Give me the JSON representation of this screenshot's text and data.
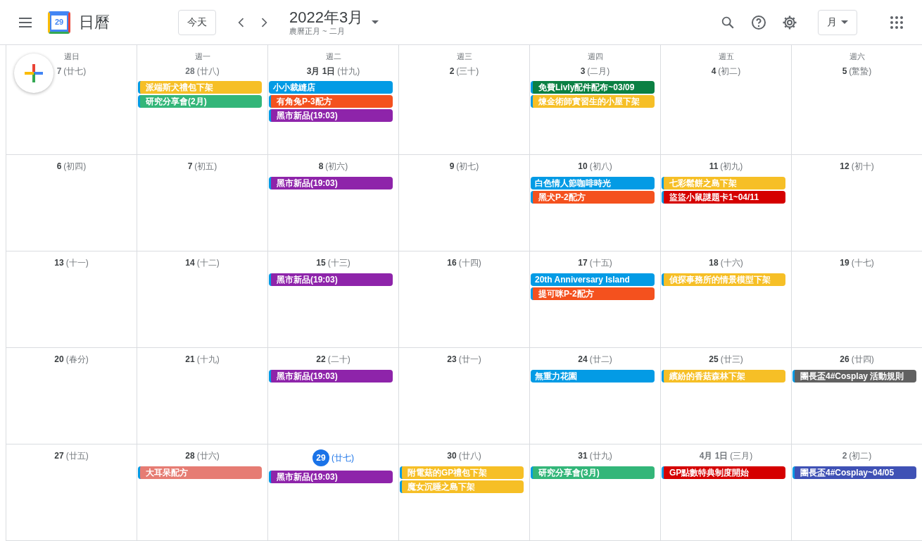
{
  "header": {
    "logo_text": "29",
    "app_name": "日曆",
    "today_button": "今天",
    "title": "2022年3月",
    "subtitle": "農曆正月 ~ 二月",
    "view_button": "月"
  },
  "weekdays": [
    "週日",
    "週一",
    "週二",
    "週三",
    "週四",
    "週五",
    "週六"
  ],
  "weeks": [
    {
      "days": [
        {
          "date": "7",
          "lunar": "(廿七)",
          "in_month": false,
          "today": false
        },
        {
          "date": "28",
          "lunar": "(廿八)",
          "in_month": false,
          "today": false,
          "events": [
            {
              "title": "派端斯犬禮包下架",
              "color": "#f6bf26",
              "striped": true
            },
            {
              "title": "研究分享會(2月)",
              "color": "#33b679",
              "striped": true
            }
          ]
        },
        {
          "date": "3月 1日",
          "lunar": "(廿九)",
          "in_month": true,
          "today": false,
          "events": [
            {
              "title": "小小裁縫店",
              "color": "#039be5",
              "striped": false
            },
            {
              "title": "有角兔P-3配方",
              "color": "#f4511e",
              "striped": true
            },
            {
              "title": "黑市新品(19:03)",
              "color": "#8e24aa",
              "striped": true
            }
          ]
        },
        {
          "date": "2",
          "lunar": "(三十)",
          "in_month": true,
          "today": false
        },
        {
          "date": "3",
          "lunar": "(二月)",
          "in_month": true,
          "today": false,
          "events": [
            {
              "title": "免費Livly配件配布~03/09",
              "color": "#0b8043",
              "striped": true
            },
            {
              "title": "煉金術師實習生的小屋下架",
              "color": "#f6bf26",
              "striped": true
            }
          ]
        },
        {
          "date": "4",
          "lunar": "(初二)",
          "in_month": true,
          "today": false
        },
        {
          "date": "5",
          "lunar": "(驚蟄)",
          "in_month": true,
          "today": false
        }
      ]
    },
    {
      "days": [
        {
          "date": "6",
          "lunar": "(初四)",
          "in_month": true,
          "today": false
        },
        {
          "date": "7",
          "lunar": "(初五)",
          "in_month": true,
          "today": false
        },
        {
          "date": "8",
          "lunar": "(初六)",
          "in_month": true,
          "today": false,
          "events": [
            {
              "title": "黑市新品(19:03)",
              "color": "#8e24aa",
              "striped": true
            }
          ]
        },
        {
          "date": "9",
          "lunar": "(初七)",
          "in_month": true,
          "today": false
        },
        {
          "date": "10",
          "lunar": "(初八)",
          "in_month": true,
          "today": false,
          "events": [
            {
              "title": "白色情人節咖啡時光",
              "color": "#039be5",
              "striped": false
            },
            {
              "title": "黑犬P-2配方",
              "color": "#f4511e",
              "striped": true
            }
          ]
        },
        {
          "date": "11",
          "lunar": "(初九)",
          "in_month": true,
          "today": false,
          "events": [
            {
              "title": "七彩鬆餅之島下架",
              "color": "#f6bf26",
              "striped": true
            },
            {
              "title": "盜盜小鼠謎題卡1~04/11",
              "color": "#d50000",
              "striped": true
            }
          ]
        },
        {
          "date": "12",
          "lunar": "(初十)",
          "in_month": true,
          "today": false
        }
      ]
    },
    {
      "days": [
        {
          "date": "13",
          "lunar": "(十一)",
          "in_month": true,
          "today": false
        },
        {
          "date": "14",
          "lunar": "(十二)",
          "in_month": true,
          "today": false
        },
        {
          "date": "15",
          "lunar": "(十三)",
          "in_month": true,
          "today": false,
          "events": [
            {
              "title": "黑市新品(19:03)",
              "color": "#8e24aa",
              "striped": true
            }
          ]
        },
        {
          "date": "16",
          "lunar": "(十四)",
          "in_month": true,
          "today": false
        },
        {
          "date": "17",
          "lunar": "(十五)",
          "in_month": true,
          "today": false,
          "events": [
            {
              "title": "20th Anniversary Island",
              "color": "#039be5",
              "striped": false
            },
            {
              "title": "提可咪P-2配方",
              "color": "#f4511e",
              "striped": true
            }
          ]
        },
        {
          "date": "18",
          "lunar": "(十六)",
          "in_month": true,
          "today": false,
          "events": [
            {
              "title": "偵探事務所的情景模型下架",
              "color": "#f6bf26",
              "striped": true
            }
          ]
        },
        {
          "date": "19",
          "lunar": "(十七)",
          "in_month": true,
          "today": false
        }
      ]
    },
    {
      "days": [
        {
          "date": "20",
          "lunar": "(春分)",
          "in_month": true,
          "today": false
        },
        {
          "date": "21",
          "lunar": "(十九)",
          "in_month": true,
          "today": false
        },
        {
          "date": "22",
          "lunar": "(二十)",
          "in_month": true,
          "today": false,
          "events": [
            {
              "title": "黑市新品(19:03)",
              "color": "#8e24aa",
              "striped": true
            }
          ]
        },
        {
          "date": "23",
          "lunar": "(廿一)",
          "in_month": true,
          "today": false
        },
        {
          "date": "24",
          "lunar": "(廿二)",
          "in_month": true,
          "today": false,
          "events": [
            {
              "title": "無重力花園",
              "color": "#039be5",
              "striped": false
            }
          ]
        },
        {
          "date": "25",
          "lunar": "(廿三)",
          "in_month": true,
          "today": false,
          "events": [
            {
              "title": "繽紛的香菇森林下架",
              "color": "#f6bf26",
              "striped": true
            }
          ]
        },
        {
          "date": "26",
          "lunar": "(廿四)",
          "in_month": true,
          "today": false,
          "events": [
            {
              "title": "團長盃4#Cosplay 活動規則",
              "color": "#616161",
              "striped": true
            }
          ]
        }
      ]
    },
    {
      "days": [
        {
          "date": "27",
          "lunar": "(廿五)",
          "in_month": true,
          "today": false
        },
        {
          "date": "28",
          "lunar": "(廿六)",
          "in_month": true,
          "today": false,
          "events": [
            {
              "title": "大耳呆配方",
              "color": "#e67c73",
              "striped": true
            }
          ]
        },
        {
          "date": "29",
          "lunar": "(廿七)",
          "in_month": true,
          "today": true,
          "events": [
            {
              "title": "黑市新品(19:03)",
              "color": "#8e24aa",
              "striped": true
            }
          ]
        },
        {
          "date": "30",
          "lunar": "(廿八)",
          "in_month": true,
          "today": false,
          "events": [
            {
              "title": "附電菇的GP禮包下架",
              "color": "#f6bf26",
              "striped": true
            },
            {
              "title": "魔女沉睡之島下架",
              "color": "#f6bf26",
              "striped": true
            }
          ]
        },
        {
          "date": "31",
          "lunar": "(廿九)",
          "in_month": true,
          "today": false,
          "events": [
            {
              "title": "研究分享會(3月)",
              "color": "#33b679",
              "striped": true
            }
          ]
        },
        {
          "date": "4月 1日",
          "lunar": "(三月)",
          "in_month": false,
          "today": false,
          "events": [
            {
              "title": "GP點數特典制度開始",
              "color": "#d50000",
              "striped": true
            }
          ]
        },
        {
          "date": "2",
          "lunar": "(初二)",
          "in_month": false,
          "today": false,
          "events": [
            {
              "title": "團長盃4#Cosplay~04/05",
              "color": "#3f51b5",
              "striped": true
            }
          ]
        }
      ]
    }
  ]
}
